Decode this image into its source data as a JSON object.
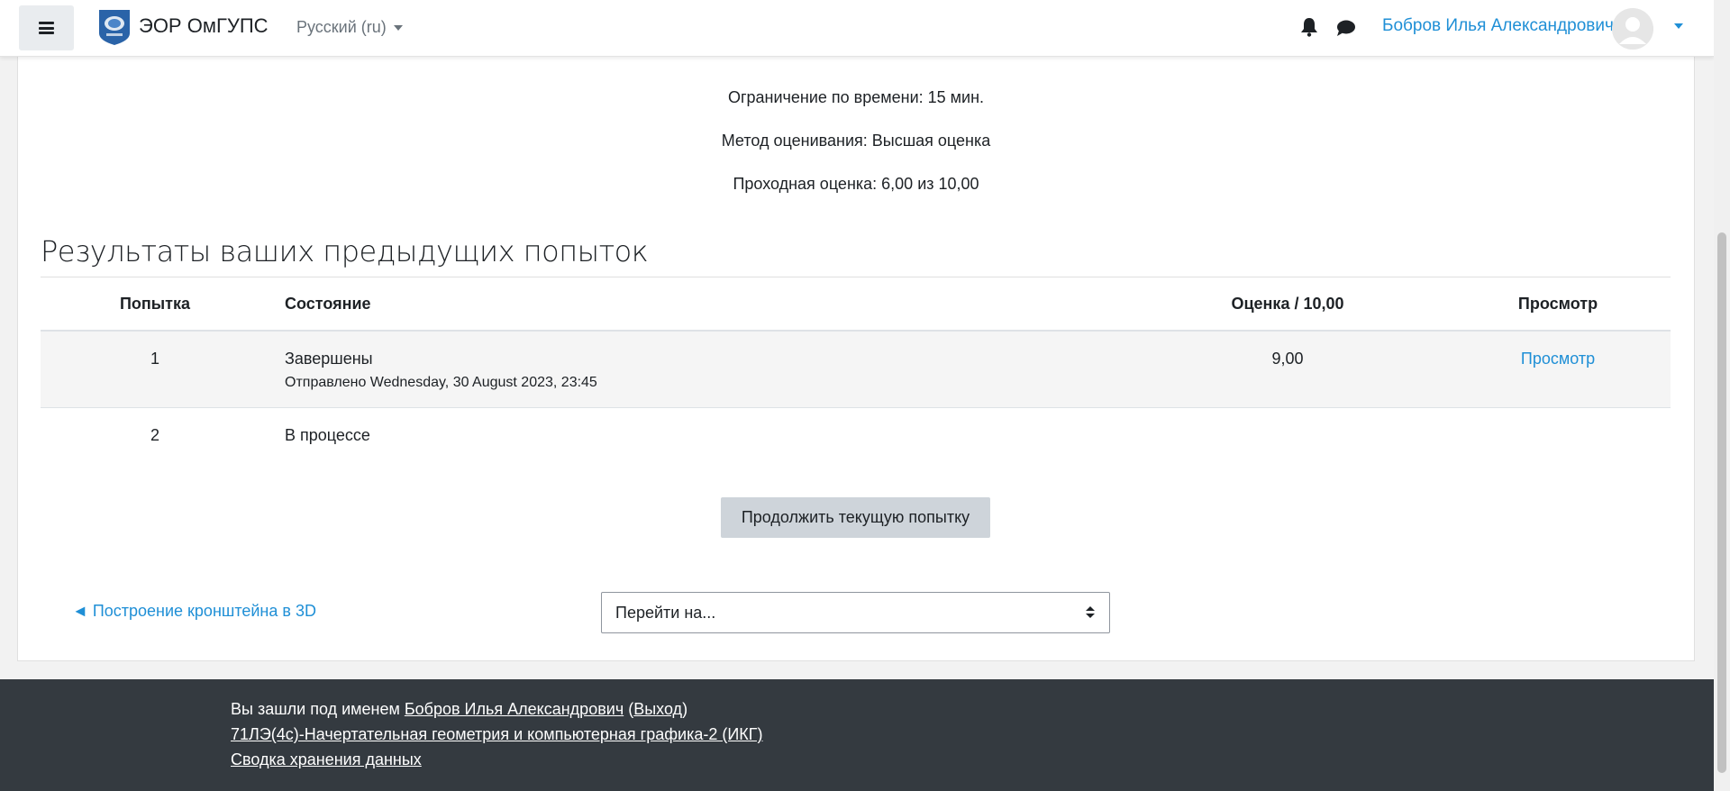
{
  "navbar": {
    "site_name": "ЭОР ОмГУПС",
    "language": "Русский (ru)",
    "user_name": "Бобров Илья Александрович"
  },
  "quiz_info": {
    "time_limit": "Ограничение по времени: 15 мин.",
    "grading_method": "Метод оценивания: Высшая оценка",
    "passing_grade": "Проходная оценка: 6,00 из 10,00"
  },
  "results": {
    "title": "Результаты ваших предыдущих попыток",
    "columns": {
      "attempt": "Попытка",
      "state": "Состояние",
      "grade": "Оценка / 10,00",
      "review": "Просмотр"
    },
    "rows": [
      {
        "attempt": "1",
        "state": "Завершены",
        "submitted": "Отправлено Wednesday, 30 August 2023, 23:45",
        "grade": "9,00",
        "review": "Просмотр"
      },
      {
        "attempt": "2",
        "state": "В процессе",
        "submitted": "",
        "grade": "",
        "review": ""
      }
    ]
  },
  "actions": {
    "continue_label": "Продолжить текущую попытку",
    "prev_activity": "◄ Построение кронштейна в 3D",
    "jump_to": "Перейти на..."
  },
  "footer": {
    "logged_in_prefix": "Вы зашли под именем ",
    "user_name": "Бобров Илья Александрович",
    "logout_open": " (",
    "logout": "Выход",
    "logout_close": ")",
    "course": "71ЛЭ(4с)-Начертательная геометрия и компьютерная графика-2 (ИКГ)",
    "data_retention": "Сводка хранения данных"
  },
  "colors": {
    "link": "#1f8fd6",
    "footer_bg": "#343a40",
    "button_bg": "#ced4da"
  }
}
